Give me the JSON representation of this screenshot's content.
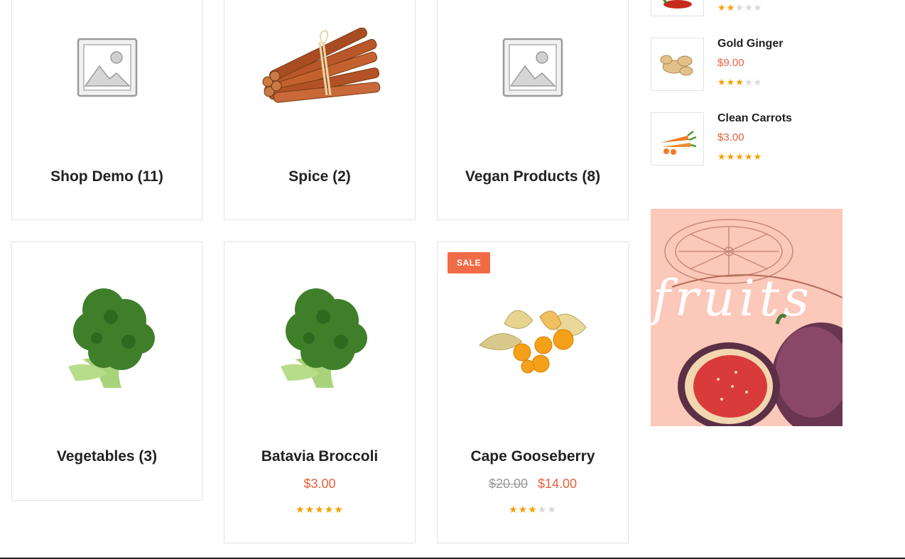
{
  "categories": [
    {
      "label": "Shop Demo (11)",
      "image": "placeholder-icon"
    },
    {
      "label": "Spice (2)",
      "image": "cinnamon"
    },
    {
      "label": "Vegan Products (8)",
      "image": "placeholder-icon"
    },
    {
      "label": "Vegetables (3)",
      "image": "broccoli"
    }
  ],
  "products": [
    {
      "name": "Batavia Broccoli",
      "price": "$3.00",
      "old_price": "",
      "rating": 5,
      "sale": false,
      "image": "broccoli"
    },
    {
      "name": "Cape Gooseberry",
      "price": "$14.00",
      "old_price": "$20.00",
      "rating": 3,
      "sale": true,
      "sale_label": "SALE",
      "image": "gooseberry"
    }
  ],
  "sidebar": {
    "top_partial_item": {
      "rating": 2,
      "image": "chili"
    },
    "items": [
      {
        "name": "Gold Ginger",
        "price": "$9.00",
        "rating": 3,
        "image": "ginger"
      },
      {
        "name": "Clean Carrots",
        "price": "$3.00",
        "rating": 5,
        "image": "carrots"
      }
    ]
  },
  "banner": {
    "text": "fruits",
    "image": "figs-and-orange",
    "background": "#fcc8b9"
  },
  "colors": {
    "accent": "#e8603c",
    "star": "#f5a000",
    "star_empty": "#d8d8d8",
    "sale_badge": "#f26b47"
  }
}
